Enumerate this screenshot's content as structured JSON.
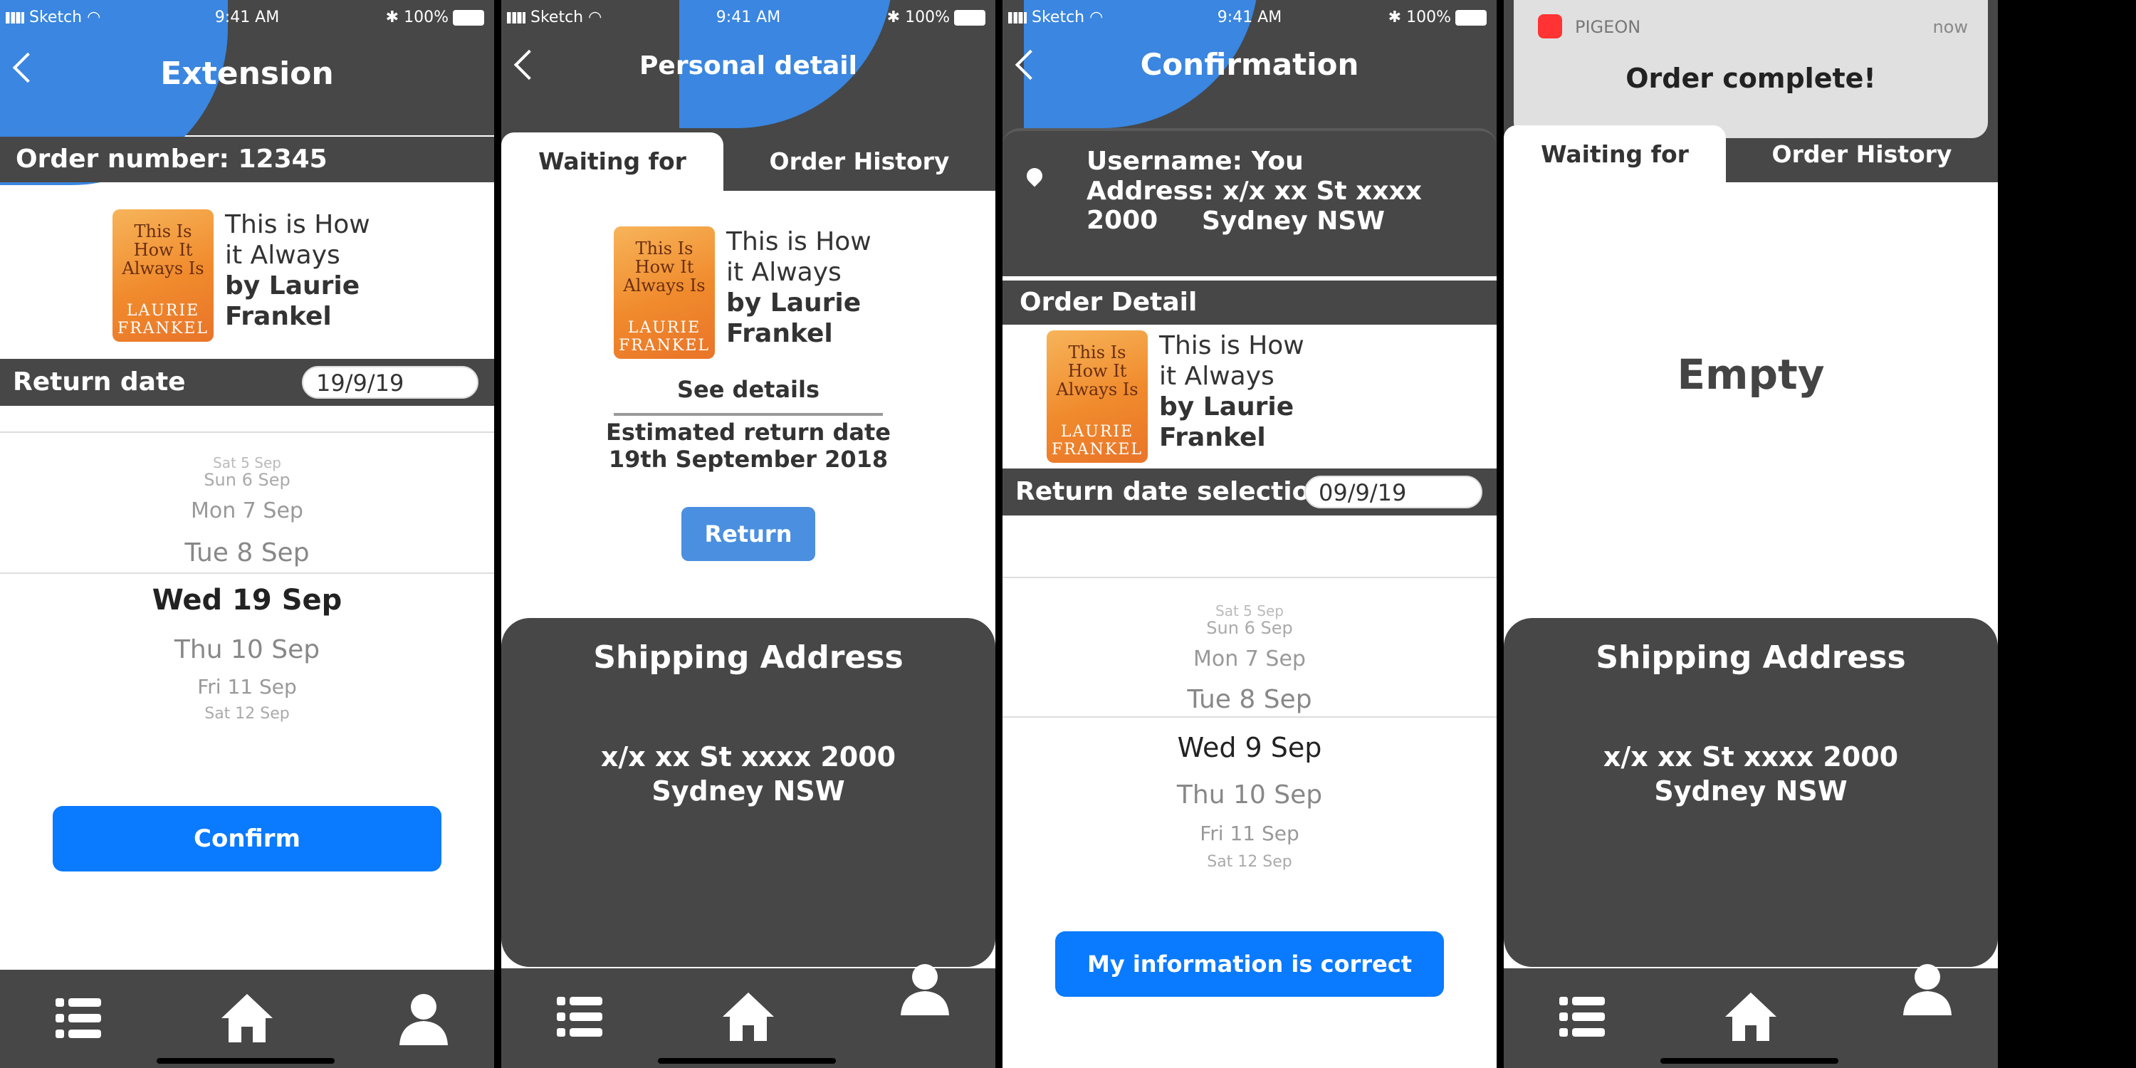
{
  "status_bar": {
    "carrier": "Sketch",
    "time": "9:41 AM",
    "battery": "100%"
  },
  "screen1": {
    "title": "Extension",
    "order_number": "Order number: 12345",
    "book": {
      "line1": "This is How",
      "line2": "it Always",
      "line3": "by Laurie",
      "line4": "Frankel",
      "cover_title": "This Is How It Always Is",
      "cover_author": "LAURIE FRANKEL"
    },
    "return_label": "Return date",
    "return_value": "19/9/19",
    "picker": [
      "Sat 5 Sep",
      "Sun 6 Sep",
      "Mon 7 Sep",
      "Tue 8 Sep",
      "Wed 19 Sep",
      "Thu 10 Sep",
      "Fri 11 Sep",
      "Sat 12 Sep"
    ],
    "confirm": "Confirm"
  },
  "screen2": {
    "title": "Personal detail",
    "tab_active": "Waiting for return",
    "tab_inactive": "Order History",
    "book": {
      "line1": "This is How",
      "line2": "it Always",
      "line3": "by Laurie",
      "line4": "Frankel"
    },
    "see_details": "See details",
    "estimate_line1": "Estimated return date",
    "estimate_line2": "19th September 2018",
    "return_button": "Return",
    "ship_title": "Shipping Address",
    "ship_line1": "x/x xx St xxxx 2000",
    "ship_line2": "Sydney NSW"
  },
  "screen3": {
    "title": "Confirmation",
    "username": "Username: You",
    "address1": "Address: x/x xx St xxxx 2000",
    "address2": "Sydney NSW",
    "order_detail": "Order Detail",
    "book": {
      "line1": "This is How",
      "line2": "it Always",
      "line3": "by Laurie",
      "line4": "Frankel"
    },
    "return_label": "Return date selection",
    "return_value": "09/9/19",
    "picker": [
      "Sat 5 Sep",
      "Sun 6 Sep",
      "Mon 7 Sep",
      "Tue 8 Sep",
      "Wed 9 Sep",
      "Thu 10 Sep",
      "Fri 11 Sep",
      "Sat 12 Sep"
    ],
    "confirm": "My information is correct"
  },
  "screen4": {
    "notif_app": "PIGEON",
    "notif_time": "now",
    "notif_message": "Order complete!",
    "tab_active": "Waiting for return",
    "tab_inactive": "Order History",
    "empty": "Empty",
    "ship_title": "Shipping Address",
    "ship_line1": "x/x xx St xxxx 2000",
    "ship_line2": "Sydney NSW"
  },
  "icons": {
    "list": "list-icon",
    "home": "home-icon",
    "profile": "profile-icon",
    "location": "location-pin-icon"
  },
  "colors": {
    "dark": "#474747",
    "accent_blue": "#3a86e0",
    "button_blue": "#0a7aff"
  }
}
